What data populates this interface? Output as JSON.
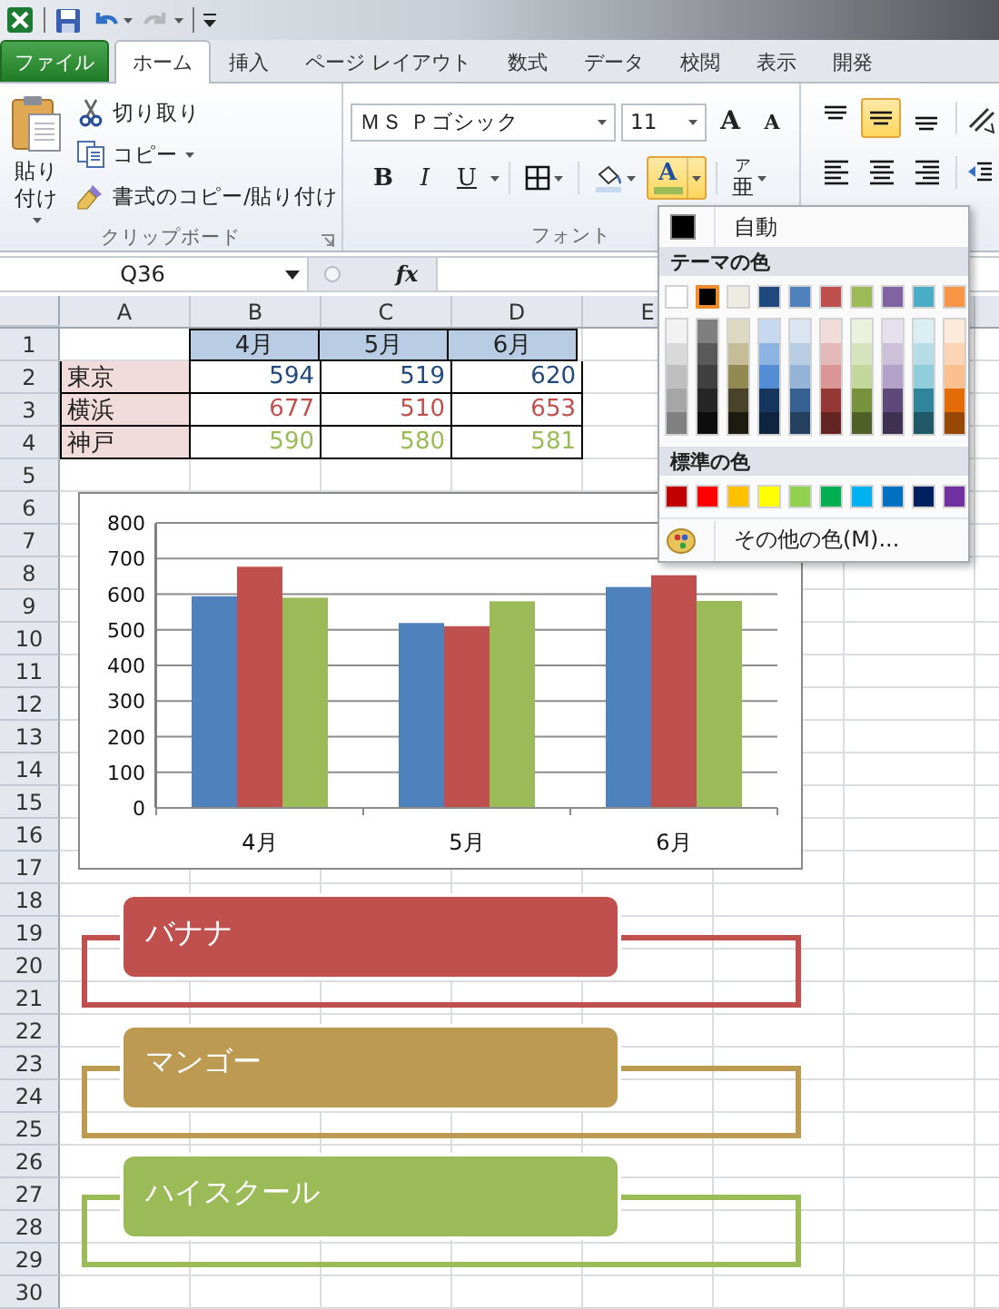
{
  "quick_access": [
    {
      "kind": "excel",
      "disabled": false
    },
    {
      "kind": "save",
      "disabled": false
    },
    {
      "kind": "undo",
      "disabled": false
    },
    {
      "kind": "redo",
      "disabled": true
    },
    {
      "kind": "customize",
      "disabled": false
    }
  ],
  "tabs": [
    {
      "label": "ファイル",
      "kind": "file",
      "selected": false
    },
    {
      "label": "ホーム",
      "kind": "tab",
      "selected": true
    },
    {
      "label": "挿入",
      "kind": "tab",
      "selected": false
    },
    {
      "label": "ページ レイアウト",
      "kind": "tab",
      "selected": false
    },
    {
      "label": "数式",
      "kind": "tab",
      "selected": false
    },
    {
      "label": "データ",
      "kind": "tab",
      "selected": false
    },
    {
      "label": "校閲",
      "kind": "tab",
      "selected": false
    },
    {
      "label": "表示",
      "kind": "tab",
      "selected": false
    },
    {
      "label": "開発",
      "kind": "tab",
      "selected": false
    }
  ],
  "clipboard_group": {
    "paste": "貼り付け",
    "label": "クリップボード",
    "commands": [
      {
        "label": "切り取り",
        "kind": "cut",
        "dropdown": false
      },
      {
        "label": "コピー",
        "kind": "copy",
        "dropdown": true
      },
      {
        "label": "書式のコピー/貼り付け",
        "kind": "format_painter",
        "dropdown": false
      }
    ]
  },
  "font_group": {
    "font_name": "ＭＳ Ｐゴシック",
    "font_size": "11",
    "grow": "A",
    "shrink": "A",
    "label": "フォント",
    "style_buttons": [
      {
        "label": "B",
        "kind": "bold"
      },
      {
        "label": "I",
        "kind": "italic"
      },
      {
        "label": "U",
        "kind": "underline"
      }
    ],
    "font_color": {
      "label": "A",
      "open": true,
      "color": "#9bbb59"
    },
    "phonetic": {
      "top": "ア",
      "bottom": "亜"
    }
  },
  "alignment_group": {
    "vertical": [
      {
        "kind": "top",
        "selected": false
      },
      {
        "kind": "middle",
        "selected": true
      },
      {
        "kind": "bottom",
        "selected": false
      }
    ],
    "horizontal": [
      {
        "kind": "left",
        "selected": false
      },
      {
        "kind": "center",
        "selected": false
      },
      {
        "kind": "right",
        "selected": false
      }
    ]
  },
  "formula_bar": {
    "name_box": "Q36",
    "fx": "fx"
  },
  "sheet": {
    "columns": [
      "A",
      "B",
      "C",
      "D",
      "E"
    ],
    "row_numbers": [
      "1",
      "2",
      "3",
      "4",
      "5",
      "6",
      "7",
      "8",
      "9",
      "10",
      "11",
      "12",
      "13",
      "14",
      "15",
      "16",
      "17",
      "18",
      "19",
      "20",
      "21",
      "22",
      "23",
      "24",
      "25",
      "26",
      "27",
      "28",
      "29",
      "30"
    ],
    "table": {
      "header": [
        "4月",
        "5月",
        "6月"
      ],
      "rows": [
        {
          "label": "東京",
          "values": [
            "594",
            "519",
            "620"
          ],
          "color": "#1f497d"
        },
        {
          "label": "横浜",
          "values": [
            "677",
            "510",
            "653"
          ],
          "color": "#c0504d"
        },
        {
          "label": "神戸",
          "values": [
            "590",
            "580",
            "581"
          ],
          "color": "#9bbb59"
        }
      ]
    }
  },
  "chart": {
    "chart_data": {
      "type": "bar",
      "grid": true,
      "categories": [
        "4月",
        "5月",
        "6月"
      ],
      "ylim": [
        0,
        800
      ],
      "yticks": [
        0,
        100,
        200,
        300,
        400,
        500,
        600,
        700,
        800
      ],
      "series": [
        {
          "color": "#4f81bd",
          "values": [
            594,
            519,
            620
          ]
        },
        {
          "color": "#c0504d",
          "values": [
            677,
            510,
            653
          ]
        },
        {
          "color": "#9bbb59",
          "values": [
            590,
            580,
            581
          ]
        }
      ]
    }
  },
  "callouts": [
    {
      "label": "バナナ",
      "color": "#c0504d"
    },
    {
      "label": "マンゴー",
      "color": "#bd9a52"
    },
    {
      "label": "ハイスクール",
      "color": "#9bbb59"
    }
  ],
  "color_menu": {
    "automatic": "自動",
    "theme_title": "テーマの色",
    "standard_title": "標準の色",
    "more": "その他の色(M)...",
    "theme_colors": [
      {
        "color": "#ffffff",
        "selected": false,
        "shades": [
          {
            "color": "#f2f2f2"
          },
          {
            "color": "#d9d9d9"
          },
          {
            "color": "#bfbfbf"
          },
          {
            "color": "#a6a6a6"
          },
          {
            "color": "#808080"
          }
        ]
      },
      {
        "color": "#000000",
        "selected": true,
        "shades": [
          {
            "color": "#7f7f7f"
          },
          {
            "color": "#595959"
          },
          {
            "color": "#404040"
          },
          {
            "color": "#262626"
          },
          {
            "color": "#0d0d0d"
          }
        ]
      },
      {
        "color": "#eeece1",
        "selected": false,
        "shades": [
          {
            "color": "#ddd9c3"
          },
          {
            "color": "#c4bd97"
          },
          {
            "color": "#938953"
          },
          {
            "color": "#494429"
          },
          {
            "color": "#1d1b10"
          }
        ]
      },
      {
        "color": "#1f497d",
        "selected": false,
        "shades": [
          {
            "color": "#c6d9f0"
          },
          {
            "color": "#8db3e2"
          },
          {
            "color": "#548dd4"
          },
          {
            "color": "#17365d"
          },
          {
            "color": "#0f243e"
          }
        ]
      },
      {
        "color": "#4f81bd",
        "selected": false,
        "shades": [
          {
            "color": "#dbe5f1"
          },
          {
            "color": "#b8cce4"
          },
          {
            "color": "#95b3d7"
          },
          {
            "color": "#366092"
          },
          {
            "color": "#244061"
          }
        ]
      },
      {
        "color": "#c0504d",
        "selected": false,
        "shades": [
          {
            "color": "#f2dcdb"
          },
          {
            "color": "#e5b9b7"
          },
          {
            "color": "#d99694"
          },
          {
            "color": "#953734"
          },
          {
            "color": "#632423"
          }
        ]
      },
      {
        "color": "#9bbb59",
        "selected": false,
        "shades": [
          {
            "color": "#ebf1dd"
          },
          {
            "color": "#d7e3bc"
          },
          {
            "color": "#c3d69b"
          },
          {
            "color": "#76923c"
          },
          {
            "color": "#4f6128"
          }
        ]
      },
      {
        "color": "#8064a2",
        "selected": false,
        "shades": [
          {
            "color": "#e5e0ec"
          },
          {
            "color": "#ccc1d9"
          },
          {
            "color": "#b2a2c7"
          },
          {
            "color": "#5f497a"
          },
          {
            "color": "#3f3151"
          }
        ]
      },
      {
        "color": "#4bacc6",
        "selected": false,
        "shades": [
          {
            "color": "#dbeef3"
          },
          {
            "color": "#b7dde8"
          },
          {
            "color": "#92cddc"
          },
          {
            "color": "#31859b"
          },
          {
            "color": "#205867"
          }
        ]
      },
      {
        "color": "#f79646",
        "selected": false,
        "shades": [
          {
            "color": "#fdeada"
          },
          {
            "color": "#fbd5b5"
          },
          {
            "color": "#fac08f"
          },
          {
            "color": "#e36c09"
          },
          {
            "color": "#974806"
          }
        ]
      }
    ],
    "standard_colors": [
      {
        "color": "#c00000"
      },
      {
        "color": "#ff0000"
      },
      {
        "color": "#ffc000"
      },
      {
        "color": "#ffff00"
      },
      {
        "color": "#92d050"
      },
      {
        "color": "#00b050"
      },
      {
        "color": "#00b0f0"
      },
      {
        "color": "#0070c0"
      },
      {
        "color": "#002060"
      },
      {
        "color": "#7030a0"
      }
    ]
  }
}
